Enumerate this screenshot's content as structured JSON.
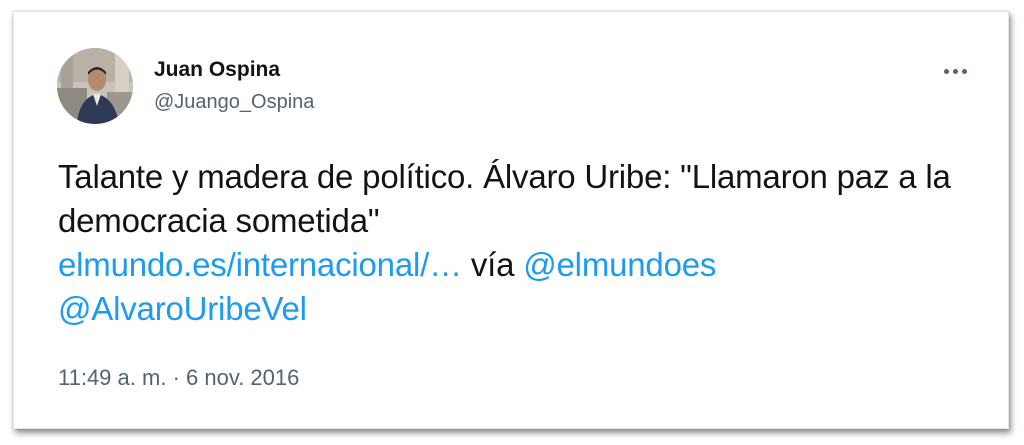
{
  "user": {
    "name": "Juan Ospina",
    "handle": "@Juango_Ospina",
    "avatar_icon": "profile-photo"
  },
  "tweet": {
    "text_part1": "Talante y madera de político. Álvaro Uribe: \"Llamaron paz a la democracia sometida\"",
    "link": "elmundo.es/internacional/…",
    "via_text": "vía",
    "mention1": "@elmundoes",
    "mention2": "@AlvaroUribeVel"
  },
  "meta": {
    "time": "11:49 a. m.",
    "separator": "·",
    "date": "6 nov. 2016"
  },
  "more_icon": "ellipsis-icon",
  "colors": {
    "text": "#0f1419",
    "secondary": "#536471",
    "link": "#1d9bf0"
  }
}
